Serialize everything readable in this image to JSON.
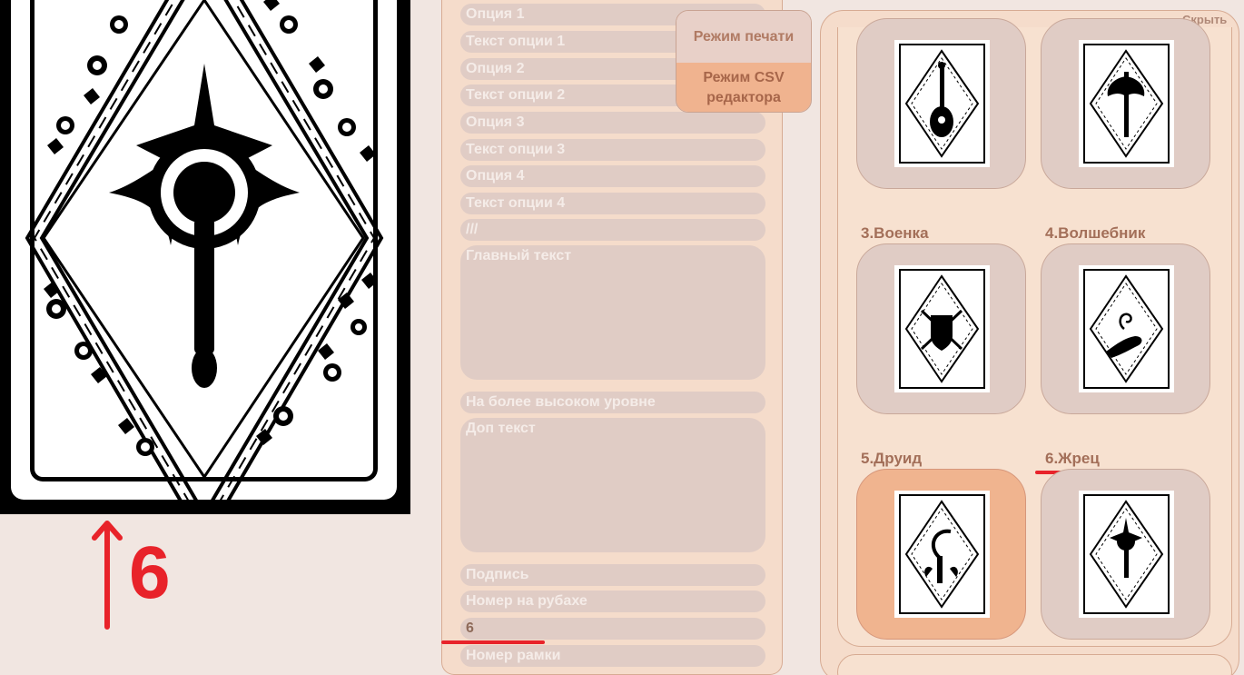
{
  "preview": {
    "annotation": "6"
  },
  "form": {
    "fields": [
      {
        "id": "option-1",
        "text": "Опция 1"
      },
      {
        "id": "option-1-text",
        "text": "Текст опции 1"
      },
      {
        "id": "option-2",
        "text": "Опция 2"
      },
      {
        "id": "option-2-text",
        "text": "Текст опции 2"
      },
      {
        "id": "option-3",
        "text": "Опция 3"
      },
      {
        "id": "option-3-text",
        "text": "Текст опции 3"
      },
      {
        "id": "option-4",
        "text": "Опция 4"
      },
      {
        "id": "option-4-text",
        "text": "Текст опции 4"
      },
      {
        "id": "separator",
        "text": "///"
      },
      {
        "id": "main-text",
        "text": "Главный текст"
      },
      {
        "id": "higher-level",
        "text": "На более высоком уровне"
      },
      {
        "id": "extra-text",
        "text": "Доп текст"
      },
      {
        "id": "signature",
        "text": "Подпись"
      },
      {
        "id": "back-number",
        "text": "Номер на рубахе"
      },
      {
        "id": "back-number-value",
        "text": "6"
      },
      {
        "id": "frame-number",
        "text": "Номер рамки"
      }
    ]
  },
  "modes": {
    "print": "Режим печати",
    "csv": "Режим CSV редактора"
  },
  "gallery": {
    "hide": "Скрыть",
    "labels": {
      "fighter": "3.Военка",
      "wizard": "4.Волшебник",
      "druid": "5.Друид",
      "cleric": "6.Жрец"
    },
    "selected": "druid"
  },
  "colors": {
    "accent": "#f0b48f",
    "annotation": "#e8232a"
  }
}
